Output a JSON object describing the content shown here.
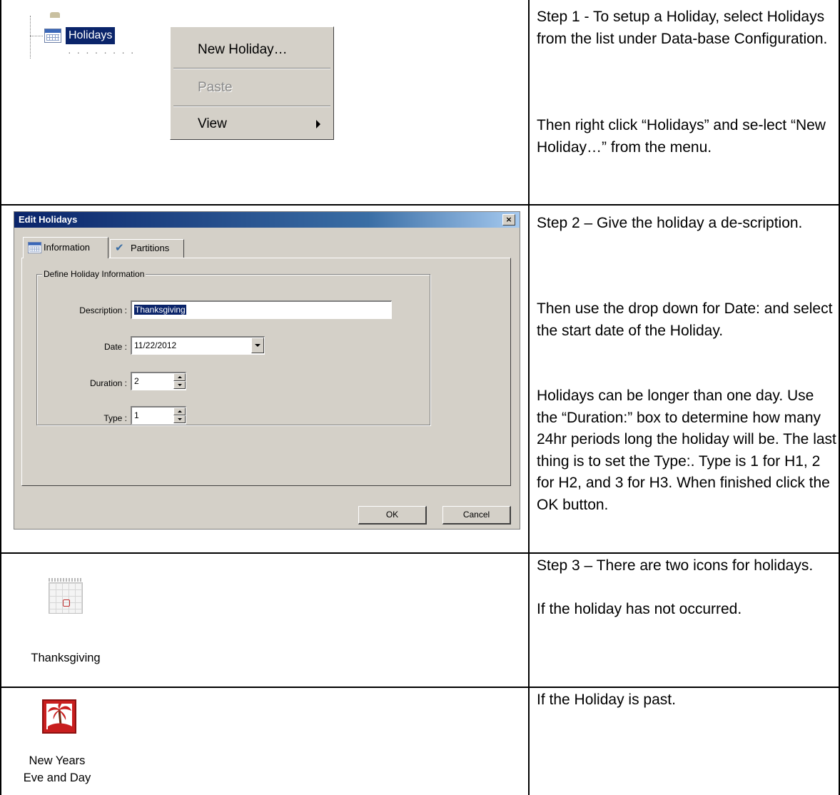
{
  "step1": {
    "tree_label": "Holidays",
    "menu_items": [
      "New Holiday…",
      "Paste",
      "View"
    ],
    "text": "Step 1 - To setup a Holiday, select Holidays from the list under Data-base Configuration.",
    "text2": "Then right click “Holidays” and se-lect “New Holiday…” from the menu."
  },
  "step2": {
    "dialog_title": "Edit Holidays",
    "close_glyph": "×",
    "tabs": [
      "Information",
      "Partitions"
    ],
    "group_title": "Define Holiday Information",
    "fields": {
      "description_label": "Description :",
      "description_value": "Thanksgiving",
      "date_label": "Date :",
      "date_value": "11/22/2012",
      "duration_label": "Duration :",
      "duration_value": "2",
      "type_label": "Type :",
      "type_value": "1"
    },
    "ok_label": "OK",
    "cancel_label": "Cancel",
    "text": "Step 2 – Give the holiday a de-scription.",
    "text2": " Then use the drop down for Date: and select the start date of the Holiday.",
    "text3": "Holidays can be longer than one day. Use the “Duration:” box to determine how many 24hr periods long the holiday will be. The last thing is to set the Type:. Type is 1 for H1, 2 for H2, and 3 for H3. When finished click the OK button."
  },
  "step3": {
    "icon_caption": "Thanksgiving",
    "text": "Step 3 – There are two icons for holidays.",
    "text2": "If the holiday has not occurred."
  },
  "step4": {
    "icon_caption_line1": "New Years",
    "icon_caption_line2": "Eve and Day",
    "text": "If the Holiday is past."
  },
  "icons": {
    "calendar": "calendar-icon",
    "partitions": "check-icon",
    "past_holiday": "palm-tree-icon"
  }
}
